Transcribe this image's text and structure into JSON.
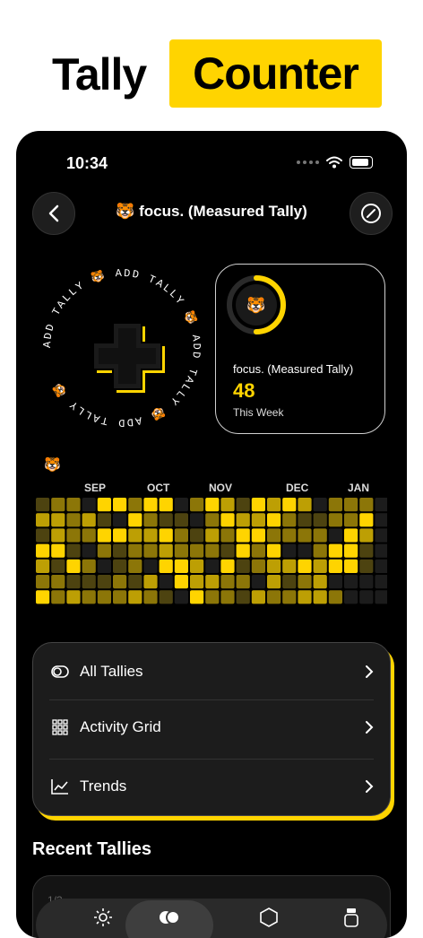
{
  "headline": {
    "word1": "Tally",
    "word2": "Counter"
  },
  "status": {
    "time": "10:34"
  },
  "nav": {
    "title": "🐯 focus. (Measured Tally)"
  },
  "add_ring": {
    "text": "ADD TALLY 🐯 ADD TALLY 🐯 ADD TALLY 🐯 ADD TALLY 🐯 "
  },
  "widget": {
    "emoji": "🐯",
    "name": "focus. (Measured Tally)",
    "value": "48",
    "caption": "This Week",
    "progress": 0.5
  },
  "activity": {
    "emoji": "🐯",
    "months": [
      "SEP",
      "OCT",
      "NOV",
      "DEC",
      "JAN"
    ],
    "levels": [
      "12204424402431434302220",
      "33231042110243342112240",
      "13224433421324422220430",
      "44102122322214240024410",
      "31420120443041233434410",
      "22111213043322031230000",
      "42322232104221322332000"
    ]
  },
  "menu": {
    "items": [
      {
        "label": "All Tallies",
        "icon": "toggle-icon"
      },
      {
        "label": "Activity Grid",
        "icon": "grid-icon"
      },
      {
        "label": "Trends",
        "icon": "chart-icon"
      }
    ]
  },
  "recent": {
    "title": "Recent Tallies",
    "peek": "1/3..."
  },
  "colors": {
    "accent": "#ffd400",
    "background": "#000000",
    "card": "#1c1c1c"
  }
}
